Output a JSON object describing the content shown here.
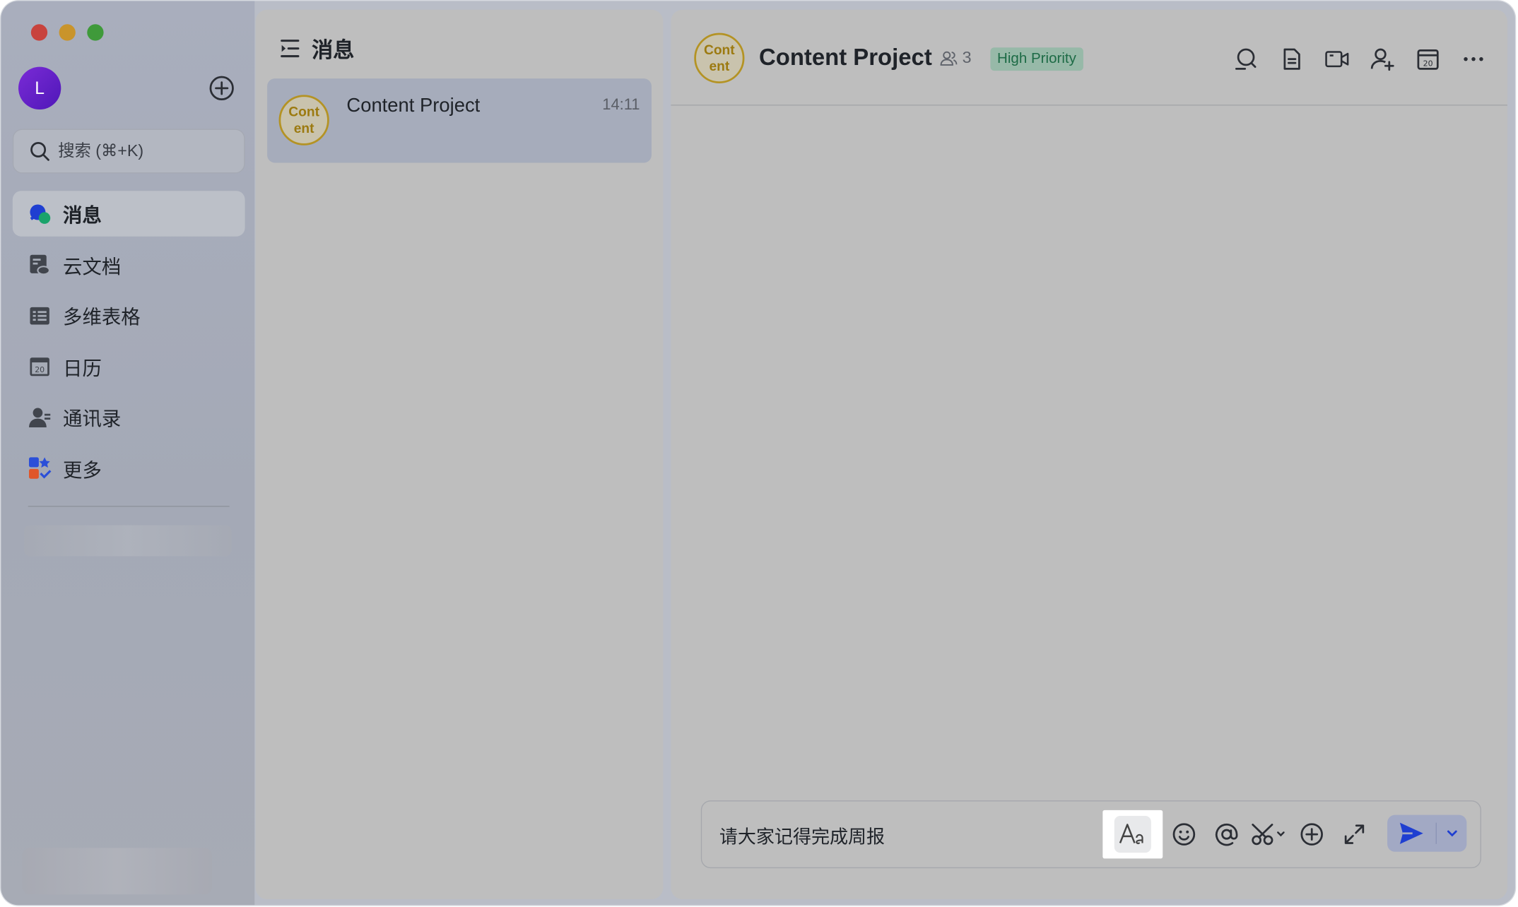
{
  "sidebar": {
    "user_initial": "L",
    "search_placeholder": "搜索 (⌘+K)",
    "nav": [
      {
        "label": "消息",
        "icon": "messages-icon",
        "active": true
      },
      {
        "label": "云文档",
        "icon": "cloud-docs-icon",
        "active": false
      },
      {
        "label": "多维表格",
        "icon": "base-table-icon",
        "active": false
      },
      {
        "label": "日历",
        "icon": "calendar-icon",
        "active": false
      },
      {
        "label": "通讯录",
        "icon": "contacts-icon",
        "active": false
      },
      {
        "label": "更多",
        "icon": "more-apps-icon",
        "active": false
      }
    ]
  },
  "chat_list": {
    "title": "消息",
    "items": [
      {
        "avatar_text": "Cont ent",
        "name": "Content Project",
        "time": "14:11"
      }
    ]
  },
  "conversation": {
    "avatar_text": "Cont ent",
    "title": "Content Project",
    "member_count": "3",
    "tag": "High Priority",
    "composer_text": "请大家记得完成周报",
    "header_icons": [
      "search-chat-icon",
      "doc-icon",
      "video-call-icon",
      "add-member-icon",
      "calendar-icon",
      "more-icon"
    ],
    "composer_tools": [
      "format-text-icon",
      "emoji-icon",
      "mention-icon",
      "screenshot-scissors-icon",
      "add-icon",
      "expand-icon"
    ]
  },
  "colors": {
    "accent_blue": "#1f3fd1",
    "avatar_purple": "#6a22cc",
    "group_avatar_gold": "#b49324",
    "tag_green": "#1d6b46"
  }
}
